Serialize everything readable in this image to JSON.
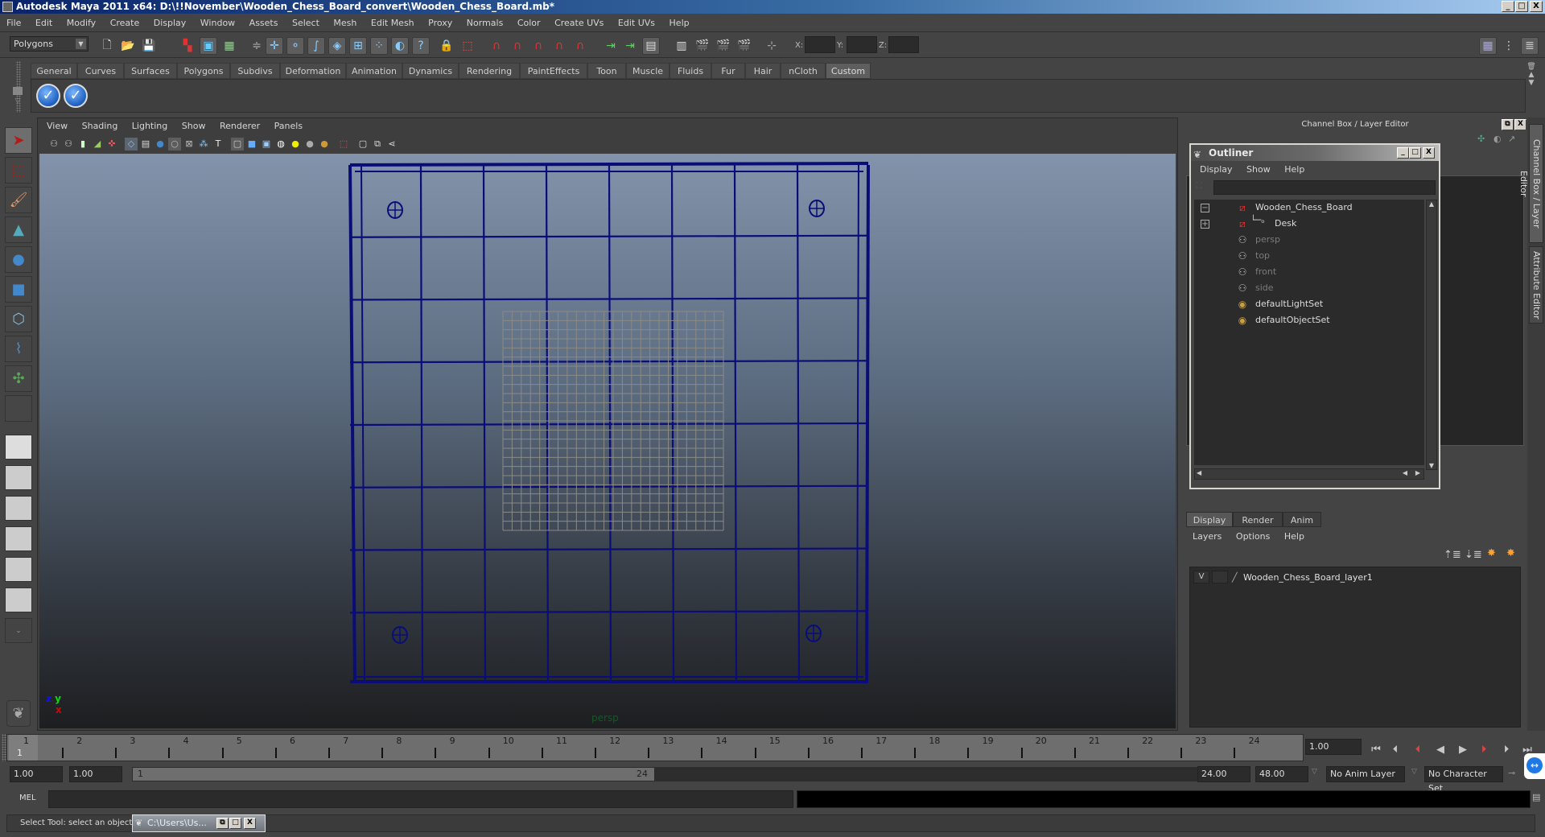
{
  "window": {
    "title": "Autodesk Maya 2011 x64: D:\\!!November\\Wooden_Chess_Board_convert\\Wooden_Chess_Board.mb*",
    "controls": {
      "minimize": "_",
      "maximize": "□",
      "close": "X"
    }
  },
  "menubar": [
    "File",
    "Edit",
    "Modify",
    "Create",
    "Display",
    "Window",
    "Assets",
    "Select",
    "Mesh",
    "Edit Mesh",
    "Proxy",
    "Normals",
    "Color",
    "Create UVs",
    "Edit UVs",
    "Help"
  ],
  "statusline": {
    "mode": "Polygons",
    "coords": {
      "x_label": "X:",
      "y_label": "Y:",
      "z_label": "Z:",
      "x": "",
      "y": "",
      "z": ""
    },
    "icons": [
      "new-scene-icon",
      "open-scene-icon",
      "save-scene-icon",
      "select-hierarchy-icon",
      "select-object-icon",
      "select-component-icon",
      "lock-selection-icon",
      "snap-grid-icon",
      "snap-curve-icon",
      "snap-point-icon",
      "snap-view-plane-icon",
      "snap-live-icon",
      "render-icon",
      "ipr-render-icon",
      "render-settings-icon",
      "hypershade-icon"
    ]
  },
  "shelf": {
    "tabs": [
      "General",
      "Curves",
      "Surfaces",
      "Polygons",
      "Subdivs",
      "Deformation",
      "Animation",
      "Dynamics",
      "Rendering",
      "PaintEffects",
      "Toon",
      "Muscle",
      "Fluids",
      "Fur",
      "Hair",
      "nCloth",
      "Custom"
    ],
    "active_tab": "Custom",
    "buttons": [
      "custom-check-icon",
      "custom-check-icon"
    ]
  },
  "toolbox": {
    "tools": [
      "select-tool",
      "lasso-tool",
      "paint-select-tool",
      "move-tool",
      "rotate-tool",
      "scale-tool",
      "universal-manipulator",
      "soft-mod-tool",
      "show-manipulator",
      "last-tool"
    ],
    "active": "select-tool"
  },
  "viewport": {
    "menu": [
      "View",
      "Shading",
      "Lighting",
      "Show",
      "Renderer",
      "Panels"
    ],
    "camera_label": "persp",
    "axis": {
      "x": "x",
      "y": "y",
      "z": "z"
    }
  },
  "channel_box": {
    "header": "Channel Box / Layer Editor"
  },
  "outliner": {
    "title": "Outliner",
    "menu": [
      "Display",
      "Show",
      "Help"
    ],
    "filter_value": "",
    "items": [
      {
        "label": "Wooden_Chess_Board",
        "type": "transform",
        "expander": "−",
        "dim": false
      },
      {
        "label": "Desk",
        "type": "transform",
        "expander": "+",
        "dim": false,
        "child": true
      },
      {
        "label": "persp",
        "type": "camera",
        "dim": true
      },
      {
        "label": "top",
        "type": "camera",
        "dim": true
      },
      {
        "label": "front",
        "type": "camera",
        "dim": true
      },
      {
        "label": "side",
        "type": "camera",
        "dim": true
      },
      {
        "label": "defaultLightSet",
        "type": "set",
        "dim": false
      },
      {
        "label": "defaultObjectSet",
        "type": "set",
        "dim": false
      }
    ]
  },
  "layer_editor": {
    "tabs": [
      "Display",
      "Render",
      "Anim"
    ],
    "active_tab": "Display",
    "menu": [
      "Layers",
      "Options",
      "Help"
    ],
    "layers": [
      {
        "visible": "V",
        "name": "Wooden_Chess_Board_layer1"
      }
    ]
  },
  "side_tabs": [
    "Channel Box / Layer Editor",
    "Attribute Editor"
  ],
  "time_slider": {
    "ticks": [
      "1",
      "2",
      "3",
      "4",
      "5",
      "6",
      "7",
      "8",
      "9",
      "10",
      "11",
      "12",
      "13",
      "14",
      "15",
      "16",
      "17",
      "18",
      "19",
      "20",
      "21",
      "22",
      "23",
      "24"
    ],
    "current_frame": "1",
    "current_time_field": "1.00"
  },
  "range_slider": {
    "start_time": "1.00",
    "playback_start": "1.00",
    "range_start": "1",
    "range_end": "24",
    "playback_end": "24.00",
    "end_time": "48.00",
    "anim_layer": "No Anim Layer",
    "character_set": "No Character Set"
  },
  "command_line": {
    "label": "MEL",
    "value": ""
  },
  "help_line": {
    "text": "Select Tool: select an object",
    "task_item": "C:\\Users\\Us..."
  }
}
